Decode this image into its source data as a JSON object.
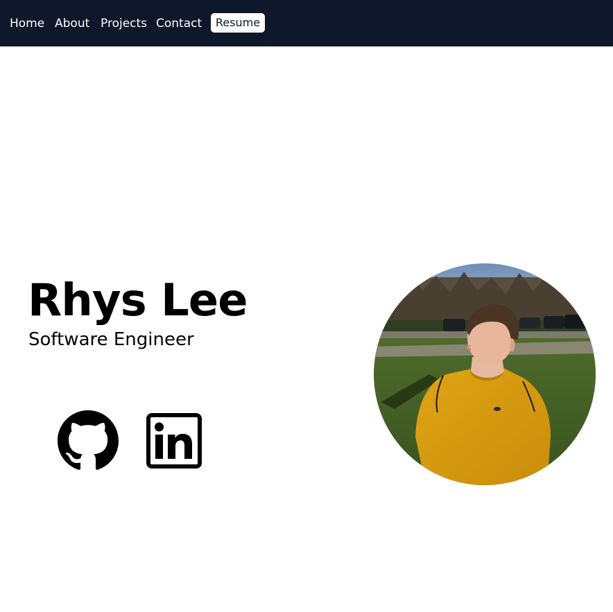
{
  "nav": {
    "items": [
      {
        "label": "Home"
      },
      {
        "label": "About"
      },
      {
        "label": "Projects"
      },
      {
        "label": "Contact"
      }
    ],
    "resume_label": "Resume"
  },
  "hero": {
    "name": "Rhys Lee",
    "title": "Software Engineer"
  },
  "social": {
    "icons": [
      "github-icon",
      "linkedin-icon"
    ]
  },
  "colors": {
    "navbar_bg": "#0f172a",
    "nav_text": "#ffffff",
    "body_bg": "#ffffff",
    "text": "#000000"
  }
}
